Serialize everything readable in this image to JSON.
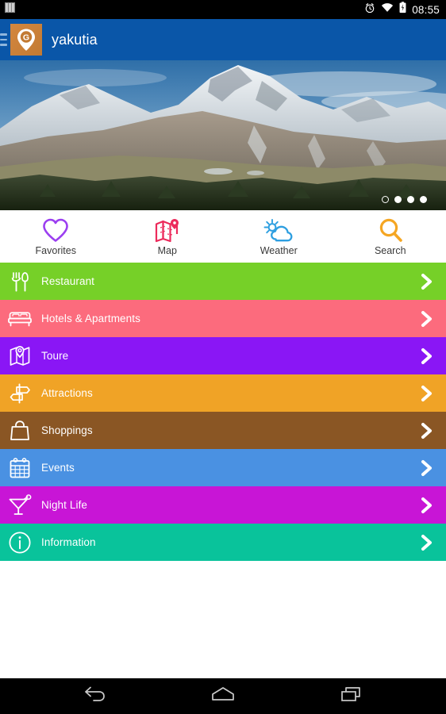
{
  "statusbar": {
    "signal_icon": "signal-bars-icon",
    "alarm_icon": "alarm-clock-icon",
    "wifi_icon": "wifi-icon",
    "battery_icon": "battery-charging-icon",
    "time": "08:55"
  },
  "appbar": {
    "menu_icon": "hamburger-menu-icon",
    "logo_icon": "map-pin-g-logo-icon",
    "logo_letter": "G",
    "title": "yakutia",
    "background_color": "#0a56a8"
  },
  "hero": {
    "image_alt": "snow-capped mountain range with green forest",
    "dots": [
      {
        "state": "hollow"
      },
      {
        "state": "filled"
      },
      {
        "state": "filled"
      },
      {
        "state": "filled"
      }
    ]
  },
  "quick_actions": [
    {
      "label": "Favorites",
      "icon": "heart-icon",
      "color": "#9b3ef0"
    },
    {
      "label": "Map",
      "icon": "map-pin-icon",
      "color": "#ec2a5b"
    },
    {
      "label": "Weather",
      "icon": "sun-cloud-icon",
      "color": "#2e9fe0"
    },
    {
      "label": "Search",
      "icon": "search-icon",
      "color": "#f5a623"
    }
  ],
  "categories": [
    {
      "label": "Restaurant",
      "icon": "cutlery-icon",
      "color": "#76d028"
    },
    {
      "label": "Hotels & Apartments",
      "icon": "bed-icon",
      "color": "#fc6b7d"
    },
    {
      "label": "Toure",
      "icon": "map-pin-icon",
      "color": "#8a16f5"
    },
    {
      "label": "Attractions",
      "icon": "signpost-icon",
      "color": "#f0a326"
    },
    {
      "label": "Shoppings",
      "icon": "shopping-bag-icon",
      "color": "#8a5624"
    },
    {
      "label": "Events",
      "icon": "calendar-icon",
      "color": "#4a91e2"
    },
    {
      "label": "Night Life",
      "icon": "cocktail-icon",
      "color": "#c815d6"
    },
    {
      "label": "Information",
      "icon": "info-circle-icon",
      "color": "#09c39b"
    }
  ],
  "navbar": {
    "back_label": "back-icon",
    "home_label": "home-icon",
    "recents_label": "recents-icon"
  }
}
